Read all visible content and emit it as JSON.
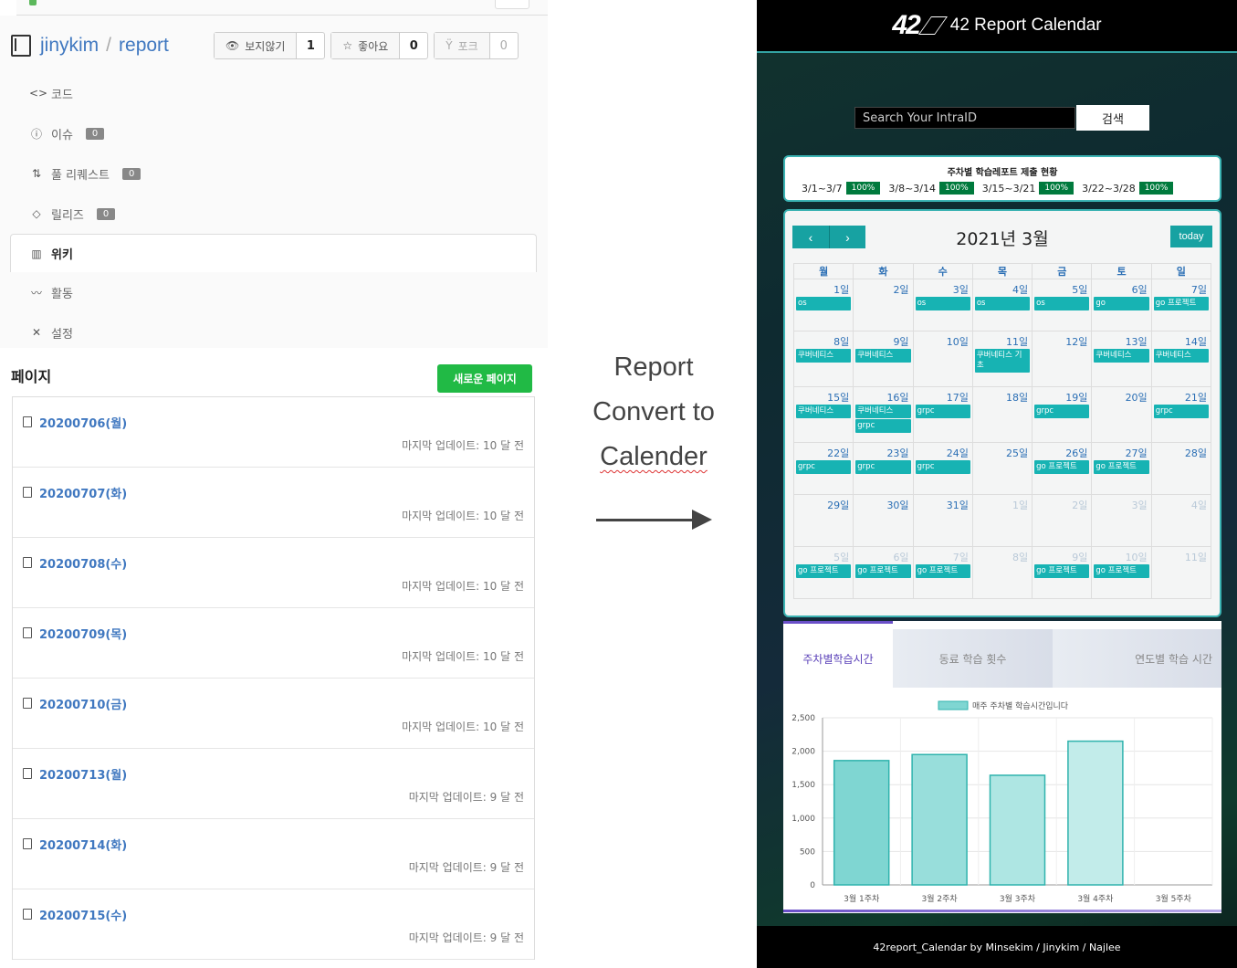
{
  "repo": {
    "owner": "jinykim",
    "separator": "/",
    "name": "report",
    "watch_label": "보지않기",
    "watch_count": "1",
    "star_label": "좋아요",
    "star_count": "0",
    "fork_label": "포크",
    "fork_count": "0"
  },
  "nav": {
    "items": [
      {
        "label": "코드",
        "icon": "code-icon"
      },
      {
        "label": "이슈",
        "icon": "issue-icon",
        "badge": "0"
      },
      {
        "label": "풀 리퀘스트",
        "icon": "pull-request-icon",
        "badge": "0"
      },
      {
        "label": "릴리즈",
        "icon": "tag-icon",
        "badge": "0"
      },
      {
        "label": "위키",
        "icon": "book-icon",
        "active": true
      },
      {
        "label": "활동",
        "icon": "pulse-icon"
      },
      {
        "label": "설정",
        "icon": "tools-icon"
      }
    ]
  },
  "pages": {
    "title": "페이지",
    "new_button": "새로운 페이지",
    "items": [
      {
        "title": "20200706(월)",
        "meta": "마지막 업데이트: 10 달 전"
      },
      {
        "title": "20200707(화)",
        "meta": "마지막 업데이트: 10 달 전"
      },
      {
        "title": "20200708(수)",
        "meta": "마지막 업데이트: 10 달 전"
      },
      {
        "title": "20200709(목)",
        "meta": "마지막 업데이트: 10 달 전"
      },
      {
        "title": "20200710(금)",
        "meta": "마지막 업데이트: 10 달 전"
      },
      {
        "title": "20200713(월)",
        "meta": "마지막 업데이트: 9 달 전"
      },
      {
        "title": "20200714(화)",
        "meta": "마지막 업데이트: 9 달 전"
      },
      {
        "title": "20200715(수)",
        "meta": "마지막 업데이트: 9 달 전"
      }
    ]
  },
  "middle": {
    "line1": "Report",
    "line2": "Convert to",
    "line3": "Calender"
  },
  "app": {
    "logo": "42",
    "title": "42 Report Calendar",
    "search_placeholder": "Search Your IntraID",
    "search_button": "검색",
    "weekly": {
      "title": "주차별 학습레포트 제출 현황",
      "items": [
        {
          "range": "3/1~3/7",
          "pct": "100%"
        },
        {
          "range": "3/8~3/14",
          "pct": "100%"
        },
        {
          "range": "3/15~3/21",
          "pct": "100%"
        },
        {
          "range": "3/22~3/28",
          "pct": "100%"
        }
      ]
    },
    "calendar": {
      "month": "2021년 3월",
      "prev": "‹",
      "next": "›",
      "today": "today",
      "weekdays": [
        "월",
        "화",
        "수",
        "목",
        "금",
        "토",
        "일"
      ],
      "weeks": [
        [
          {
            "d": "1일",
            "ev": [
              "os"
            ]
          },
          {
            "d": "2일",
            "ev": []
          },
          {
            "d": "3일",
            "ev": [
              "os"
            ]
          },
          {
            "d": "4일",
            "ev": [
              "os"
            ]
          },
          {
            "d": "5일",
            "ev": [
              "os"
            ]
          },
          {
            "d": "6일",
            "ev": [
              "go"
            ]
          },
          {
            "d": "7일",
            "ev": [
              "go 프로젝트"
            ]
          }
        ],
        [
          {
            "d": "8일",
            "ev": [
              "쿠버네티스"
            ]
          },
          {
            "d": "9일",
            "ev": [
              "쿠버네티스"
            ]
          },
          {
            "d": "10일",
            "ev": []
          },
          {
            "d": "11일",
            "ev": [
              "쿠버네티스 기초"
            ]
          },
          {
            "d": "12일",
            "ev": []
          },
          {
            "d": "13일",
            "ev": [
              "쿠버네티스"
            ]
          },
          {
            "d": "14일",
            "ev": [
              "쿠버네티스"
            ]
          }
        ],
        [
          {
            "d": "15일",
            "ev": [
              "쿠버네티스"
            ]
          },
          {
            "d": "16일",
            "ev": [
              "쿠버네티스",
              "grpc"
            ]
          },
          {
            "d": "17일",
            "ev": [
              "grpc"
            ]
          },
          {
            "d": "18일",
            "ev": []
          },
          {
            "d": "19일",
            "ev": [
              "grpc"
            ]
          },
          {
            "d": "20일",
            "ev": []
          },
          {
            "d": "21일",
            "ev": [
              "grpc"
            ]
          }
        ],
        [
          {
            "d": "22일",
            "ev": [
              "grpc"
            ]
          },
          {
            "d": "23일",
            "ev": [
              "grpc"
            ]
          },
          {
            "d": "24일",
            "ev": [
              "grpc"
            ]
          },
          {
            "d": "25일",
            "ev": []
          },
          {
            "d": "26일",
            "ev": [
              "go 프로젝트"
            ]
          },
          {
            "d": "27일",
            "ev": [
              "go 프로젝트"
            ]
          },
          {
            "d": "28일",
            "ev": []
          }
        ],
        [
          {
            "d": "29일",
            "ev": []
          },
          {
            "d": "30일",
            "ev": []
          },
          {
            "d": "31일",
            "ev": []
          },
          {
            "d": "1일",
            "ev": [],
            "other": true
          },
          {
            "d": "2일",
            "ev": [],
            "other": true
          },
          {
            "d": "3일",
            "ev": [],
            "other": true
          },
          {
            "d": "4일",
            "ev": [],
            "other": true
          }
        ],
        [
          {
            "d": "5일",
            "ev": [
              "go 프로젝트"
            ],
            "other": true
          },
          {
            "d": "6일",
            "ev": [
              "go 프로젝트"
            ],
            "other": true
          },
          {
            "d": "7일",
            "ev": [
              "go 프로젝트"
            ],
            "other": true
          },
          {
            "d": "8일",
            "ev": [],
            "other": true
          },
          {
            "d": "9일",
            "ev": [
              "go 프로젝트"
            ],
            "other": true
          },
          {
            "d": "10일",
            "ev": [
              "go 프로젝트"
            ],
            "other": true
          },
          {
            "d": "11일",
            "ev": [],
            "other": true
          }
        ]
      ]
    },
    "tabs": [
      "주차별학습시간",
      "동료 학습 횟수",
      "연도별 학습 시간"
    ],
    "footer": "42report_Calendar by Minsekim / Jinykim / Najlee"
  },
  "colors": {
    "accent": "#17a2a2",
    "success": "#007a3d",
    "link": "#4078c0",
    "new_button": "#21ba45",
    "tab_active": "#5a40b8"
  },
  "chart_data": {
    "type": "bar",
    "legend": "매주 주차별 학습시간입니다",
    "categories": [
      "3월 1주차",
      "3월 2주차",
      "3월 3주차",
      "3월 4주차",
      "3월 5주차"
    ],
    "values": [
      1860,
      1950,
      1640,
      2150,
      0
    ],
    "yticks": [
      0,
      500,
      1000,
      1500,
      2000,
      2500
    ],
    "ytick_labels": [
      "0",
      "500",
      "1,000",
      "1,500",
      "2,000",
      "2,500"
    ],
    "ylim": [
      0,
      2500
    ],
    "grid": true,
    "legend_position": "top-center"
  }
}
